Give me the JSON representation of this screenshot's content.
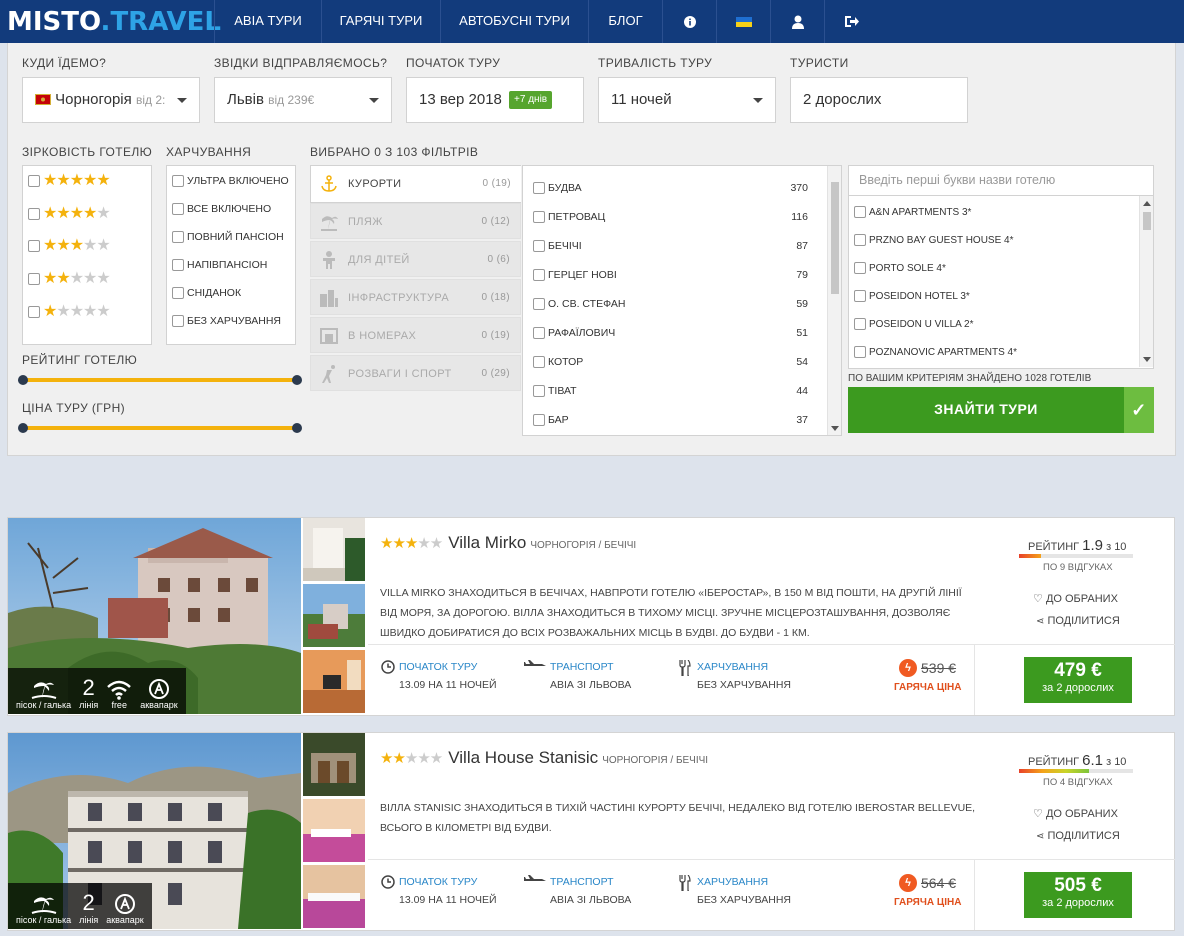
{
  "header": {
    "logo_a": "MISTO",
    "logo_dot": ".",
    "logo_b": "TRAVEL",
    "nav": [
      "АВІА ТУРИ",
      "ГАРЯЧІ ТУРИ",
      "АВТОБУСНІ ТУРИ",
      "БЛОГ"
    ],
    "icons": [
      "info-icon",
      "ukraine-flag-icon",
      "user-icon",
      "logout-icon"
    ]
  },
  "search": {
    "destination": {
      "label": "КУДИ ЇДЕМО?",
      "value": "Чорногорія",
      "sub": "від 2:"
    },
    "departure": {
      "label": "ЗВІДКИ ВІДПРАВЛЯЄМОСЬ?",
      "value": "Львів",
      "sub": "від 239€"
    },
    "start": {
      "label": "ПОЧАТОК ТУРУ",
      "value": "13 вер 2018",
      "badge": "+7 днів"
    },
    "duration": {
      "label": "ТРИВАЛІСТЬ ТУРУ",
      "value": "11 ночей"
    },
    "tourists": {
      "label": "ТУРИСТИ",
      "value": "2 дорослих"
    }
  },
  "filters": {
    "stars_label": "ЗІРКОВІСТЬ ГОТЕЛЮ",
    "stars": [
      5,
      4,
      3,
      2,
      1
    ],
    "meals_label": "ХАРЧУВАННЯ",
    "meals": [
      "УЛЬТРА ВКЛЮЧЕНО",
      "ВСЕ ВКЛЮЧЕНО",
      "ПОВНИЙ ПАНСІОН",
      "НАПІВПАНСІОН",
      "СНІДАНОК",
      "БЕЗ ХАРЧУВАННЯ"
    ],
    "rating_label": "РЕЙТИНГ ГОТЕЛЮ",
    "price_label": "ЦІНА ТУРУ (ГРН)",
    "selected_label": "ВИБРАНО 0 З 103 ФІЛЬТРІВ",
    "tabs": [
      {
        "label": "КУРОРТИ",
        "count": "0 (19)"
      },
      {
        "label": "ПЛЯЖ",
        "count": "0 (12)"
      },
      {
        "label": "ДЛЯ ДІТЕЙ",
        "count": "0 (6)"
      },
      {
        "label": "ІНФРАСТРУКТУРА",
        "count": "0 (18)"
      },
      {
        "label": "В НОМЕРАХ",
        "count": "0 (19)"
      },
      {
        "label": "РОЗВАГИ І СПОРТ",
        "count": "0 (29)"
      }
    ],
    "resorts": [
      {
        "name": "БУДВА",
        "count": "370"
      },
      {
        "name": "ПЕТРОВАЦ",
        "count": "116"
      },
      {
        "name": "БЕЧІЧІ",
        "count": "87"
      },
      {
        "name": "ГЕРЦЕГ НОВІ",
        "count": "79"
      },
      {
        "name": "О. СВ. СТЕФАН",
        "count": "59"
      },
      {
        "name": "РАФАЇЛОВИЧ",
        "count": "51"
      },
      {
        "name": "КОТОР",
        "count": "54"
      },
      {
        "name": "ТІВАТ",
        "count": "44"
      },
      {
        "name": "БАР",
        "count": "37"
      }
    ],
    "hotel_search_placeholder": "Введіть перші букви назви готелю",
    "hotels": [
      "A&N APARTMENTS 3*",
      "PRZNO BAY GUEST HOUSE 4*",
      "PORTO SOLE 4*",
      "POSEIDON HOTEL 3*",
      "POSEIDON U VILLA 2*",
      "POZNANOVIC APARTMENTS 4*"
    ],
    "found": "ПО ВАШИМ КРИТЕРІЯМ ЗНАЙДЕНО 1028 ГОТЕЛІВ",
    "find_button": "ЗНАЙТИ ТУРИ",
    "find_check": "✓"
  },
  "listings": [
    {
      "stars": 3,
      "name": "Villa Mirko",
      "location": "ЧОРНОГОРІЯ / БЕЧІЧІ",
      "description": "VILLA MIRKO ЗНАХОДИТЬСЯ В БЕЧІЧАХ, НАВПРОТИ ГОТЕЛЮ «ІБЕРОСТАР», В 150 М ВІД ПОШТИ, НА ДРУГІЙ ЛІНІЇ ВІД МОРЯ, ЗА ДОРОГОЮ. ВІЛЛА ЗНАХОДИТЬСЯ В ТИХОМУ МІСЦІ. ЗРУЧНЕ МІСЦЕРОЗТАШУВАННЯ, ДОЗВОЛЯЄ ШВИДКО ДОБИРАТИСЯ ДО ВСІХ РОЗВАЖАЛЬНИХ МІСЦЬ В БУДВІ. ДО БУДВИ - 1 КМ.",
      "amenities": [
        {
          "icon": "beach-icon",
          "big": "",
          "label": "пісок / галька"
        },
        {
          "icon": "",
          "big": "2",
          "label": "лінія"
        },
        {
          "icon": "wifi-icon",
          "big": "",
          "label": "free"
        },
        {
          "icon": "aquapark-icon",
          "big": "",
          "label": "аквапарк"
        }
      ],
      "start_label": "ПОЧАТОК ТУРУ",
      "start_value": "13.09 НА 11 НОЧЕЙ",
      "transport_label": "ТРАНСПОРТ",
      "transport_value": "АВІА ЗІ ЛЬВОВА",
      "meal_label": "ХАРЧУВАННЯ",
      "meal_value": "БЕЗ ХАРЧУВАННЯ",
      "old_price": "539 €",
      "hot_label": "ГАРЯЧА ЦІНА",
      "price": "479 €",
      "price_sub": "за 2 дорослих",
      "rating_label": "РЕЙТИНГ",
      "rating": "1.9",
      "rating_max": "з 10",
      "rating_fraction": 0.19,
      "reviews": "ПО 9 ВІДГУКАХ",
      "favorite": "ДО ОБРАНИХ",
      "share": "ПОДІЛИТИСЯ"
    },
    {
      "stars": 2,
      "name": "Villa House Stanisic",
      "location": "ЧОРНОГОРІЯ / БЕЧІЧІ",
      "description": "ВІЛЛА STANISIC ЗНАХОДИТЬСЯ В ТИХІЙ ЧАСТИНІ КУРОРТУ БЕЧІЧІ, НЕДАЛЕКО ВІД ГОТЕЛЮ IBEROSTAR BELLEVUE, ВСЬОГО В КІЛОМЕТРІ ВІД БУДВИ.",
      "amenities": [
        {
          "icon": "beach-icon",
          "big": "",
          "label": "пісок / галька"
        },
        {
          "icon": "",
          "big": "2",
          "label": "лінія"
        },
        {
          "icon": "aquapark-icon",
          "big": "",
          "label": "аквапарк"
        }
      ],
      "start_label": "ПОЧАТОК ТУРУ",
      "start_value": "13.09 НА 11 НОЧЕЙ",
      "transport_label": "ТРАНСПОРТ",
      "transport_value": "АВІА ЗІ ЛЬВОВА",
      "meal_label": "ХАРЧУВАННЯ",
      "meal_value": "БЕЗ ХАРЧУВАННЯ",
      "old_price": "564 €",
      "hot_label": "ГАРЯЧА ЦІНА",
      "price": "505 €",
      "price_sub": "за 2 дорослих",
      "rating_label": "РЕЙТИНГ",
      "rating": "6.1",
      "rating_max": "з 10",
      "rating_fraction": 0.61,
      "reviews": "ПО 4 ВІДГУКАХ",
      "favorite": "ДО ОБРАНИХ",
      "share": "ПОДІЛИТИСЯ"
    }
  ]
}
